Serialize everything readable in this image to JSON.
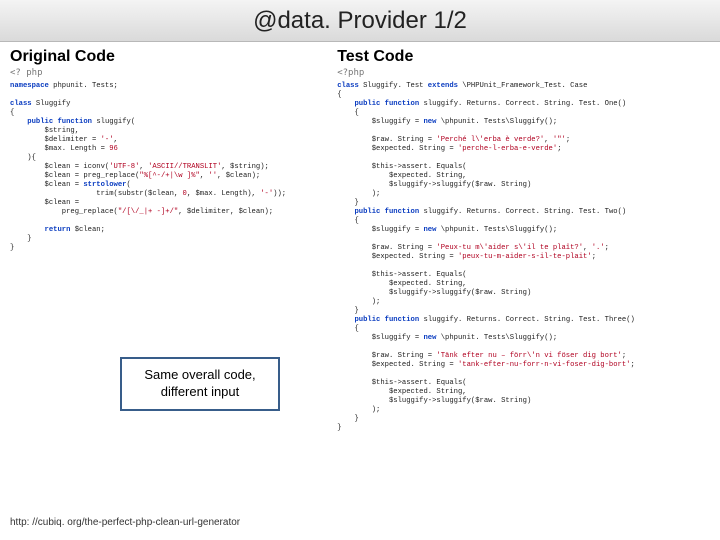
{
  "title": "@data. Provider 1/2",
  "left": {
    "heading": "Original Code",
    "phpOpen": "<? php",
    "code": "<span class='kw'>namespace</span> phpunit. Tests;\n\n<span class='kw'>class</span> Sluggify\n{\n    <span class='kw'>public</span> <span class='kw'>function</span> sluggify(\n        $string,\n        $delimiter = <span class='str'>'-'</span>,\n        $max. Length = <span class='num'>96</span>\n    ){\n        $clean = iconv(<span class='str'>'UTF-8'</span>, <span class='str'>'ASCII//TRANSLIT'</span>, $string);\n        $clean = preg_replace(<span class='str'>\"%[^-/+|\\w ]%\"</span>, <span class='str'>''</span>, $clean);\n        $clean = <span class='kw'>strtolower</span>(\n                    trim(substr($clean, <span class='num'>0</span>, $max. Length), <span class='str'>'-'</span>));\n        $clean = \n            preg_replace(<span class='str'>\"/[\\/_|+ -]+/\"</span>, $delimiter, $clean);\n\n        <span class='kw'>return</span> $clean;\n    }\n}"
  },
  "right": {
    "heading": "Test Code",
    "phpOpen": "<?php",
    "code": "<span class='kw'>class</span> Sluggify. Test <span class='kw'>extends</span> \\PHPUnit_Framework_Test. Case\n{\n    <span class='kw'>public</span> <span class='kw'>function</span> sluggify. Returns. Correct. String. Test. One()\n    {\n        $sluggify = <span class='kw'>new</span> \\phpunit. Tests\\Sluggify();\n\n        $raw. String = <span class='str'>'Perch&#233; l\\'erba &#232; verde?'</span>, <span class='str'>'\"'</span>;\n        $expected. String = <span class='str'>'perche-l-erba-e-verde'</span>;\n\n        $this-&gt;assert. Equals(\n            $expected. String,\n            $sluggify-&gt;sluggify($raw. String)\n        );\n    }\n    <span class='kw'>public</span> <span class='kw'>function</span> sluggify. Returns. Correct. String. Test. Two()\n    {\n        $sluggify = <span class='kw'>new</span> \\phpunit. Tests\\Sluggify();\n\n        $raw. String = <span class='str'>'Peux-tu m\\'aider s\\'il te pla&#238;t?'</span>, <span class='str'>'.'</span>;\n        $expected. String = <span class='str'>'peux-tu-m-aider-s-il-te-plait'</span>;\n\n        $this-&gt;assert. Equals(\n            $expected. String,\n            $sluggify-&gt;sluggify($raw. String)\n        );\n    }\n    <span class='kw'>public</span> <span class='kw'>function</span> sluggify. Returns. Correct. String. Test. Three()\n    {\n        $sluggify = <span class='kw'>new</span> \\phpunit. Tests\\Sluggify();\n\n        $raw. String = <span class='str'>'T&#228;nk efter nu &#8211; f&#246;rr\\'n vi f&#246;ser dig bort'</span>;\n        $expected. String = <span class='str'>'tank-efter-nu-forr-n-vi-foser-dig-bort'</span>;\n\n        $this-&gt;assert. Equals(\n            $expected. String,\n            $sluggify-&gt;sluggify($raw. String)\n        );\n    }\n}"
  },
  "callout": "Same overall code, different input",
  "cite": "http: //cubiq. org/the-perfect-php-clean-url-generator"
}
